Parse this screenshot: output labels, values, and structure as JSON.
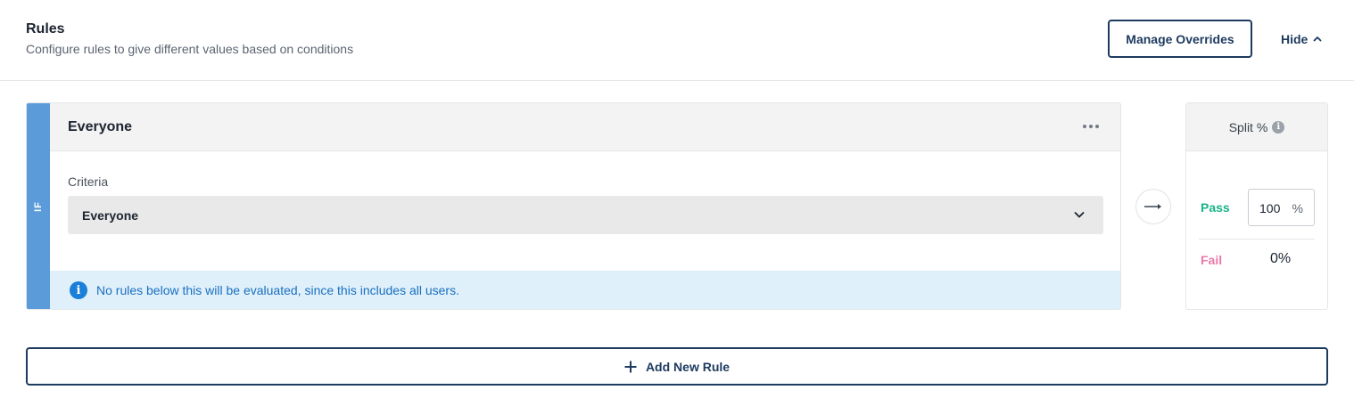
{
  "header": {
    "title": "Rules",
    "subtitle": "Configure rules to give different values based on conditions",
    "manage_overrides_label": "Manage Overrides",
    "hide_label": "Hide"
  },
  "rule": {
    "condition_keyword": "IF",
    "name": "Everyone",
    "criteria_label": "Criteria",
    "criteria_value": "Everyone",
    "info_text": "No rules below this will be evaluated, since this includes all users."
  },
  "split": {
    "title": "Split %",
    "pass_label": "Pass",
    "pass_value": "100",
    "pass_unit": "%",
    "fail_label": "Fail",
    "fail_value": "0%"
  },
  "footer": {
    "add_rule_label": "Add New Rule"
  },
  "colors": {
    "accent": "#1d3a5f",
    "if_bar": "#5b9bd9",
    "pass": "#19b38b",
    "fail": "#ea7aa8",
    "info": "#1a7fd8"
  },
  "icons": [
    "chevron-up-icon",
    "more-icon",
    "chevron-down-icon",
    "info-icon",
    "arrow-right-icon",
    "plus-icon"
  ]
}
